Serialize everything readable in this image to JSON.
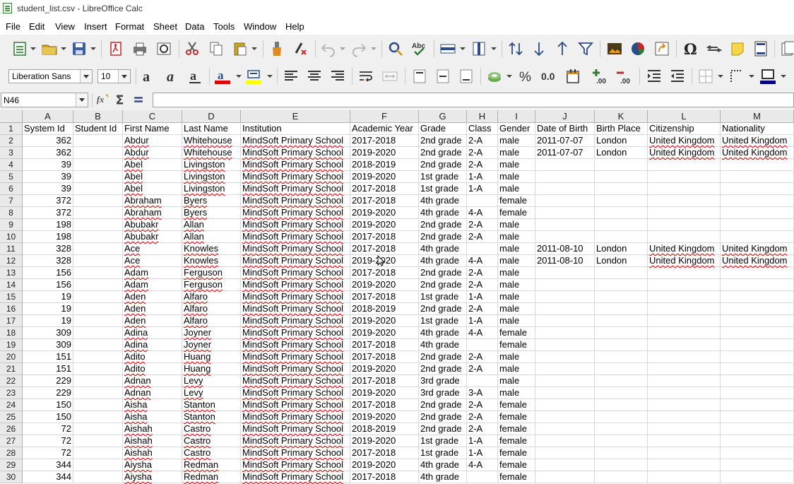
{
  "window": {
    "title": "student_list.csv - LibreOffice Calc"
  },
  "menu": [
    "File",
    "Edit",
    "View",
    "Insert",
    "Format",
    "Sheet",
    "Data",
    "Tools",
    "Window",
    "Help"
  ],
  "format": {
    "font_name": "Liberation Sans",
    "font_size": "10"
  },
  "formula_bar": {
    "cell_ref": "N46",
    "value": ""
  },
  "sheet": {
    "columns": [
      "A",
      "B",
      "C",
      "D",
      "E",
      "F",
      "G",
      "H",
      "I",
      "J",
      "K",
      "L",
      "M"
    ],
    "row_numbers": [
      "1",
      "2",
      "3",
      "4",
      "5",
      "6",
      "7",
      "8",
      "9",
      "10",
      "11",
      "12",
      "13",
      "14",
      "15",
      "16",
      "17",
      "18",
      "19",
      "20",
      "21",
      "22",
      "23",
      "24",
      "25",
      "26",
      "27",
      "28",
      "29",
      "30"
    ],
    "rows": [
      [
        "System Id",
        "Student Id",
        "First Name",
        "Last Name",
        "Institution",
        "Academic Year",
        "Grade",
        "Class",
        "Gender",
        "Date of Birth",
        "Birth Place",
        "Citizenship",
        "Nationality"
      ],
      [
        "362",
        "",
        "Abdur",
        "Whitehouse",
        "MindSoft Primary School",
        "2017-2018",
        "2nd grade",
        "2-A",
        "male",
        "2011-07-07",
        "London",
        "United Kingdom",
        "United Kingdom"
      ],
      [
        "362",
        "",
        "Abdur",
        "Whitehouse",
        "MindSoft Primary School",
        "2019-2020",
        "2nd grade",
        "2-A",
        "male",
        "2011-07-07",
        "London",
        "United Kingdom",
        "United Kingdom"
      ],
      [
        "39",
        "",
        "Abel",
        "Livingston",
        "MindSoft Primary School",
        "2018-2019",
        "2nd grade",
        "2-A",
        "male",
        "",
        "",
        "",
        ""
      ],
      [
        "39",
        "",
        "Abel",
        "Livingston",
        "MindSoft Primary School",
        "2019-2020",
        "1st grade",
        "1-A",
        "male",
        "",
        "",
        "",
        ""
      ],
      [
        "39",
        "",
        "Abel",
        "Livingston",
        "MindSoft Primary School",
        "2017-2018",
        "1st grade",
        "1-A",
        "male",
        "",
        "",
        "",
        ""
      ],
      [
        "372",
        "",
        "Abraham",
        "Byers",
        "MindSoft Primary School",
        "2017-2018",
        "4th grade",
        "",
        "female",
        "",
        "",
        "",
        ""
      ],
      [
        "372",
        "",
        "Abraham",
        "Byers",
        "MindSoft Primary School",
        "2019-2020",
        "4th grade",
        "4-A",
        "female",
        "",
        "",
        "",
        ""
      ],
      [
        "198",
        "",
        "Abubakr",
        "Allan",
        "MindSoft Primary School",
        "2019-2020",
        "2nd grade",
        "2-A",
        "male",
        "",
        "",
        "",
        ""
      ],
      [
        "198",
        "",
        "Abubakr",
        "Allan",
        "MindSoft Primary School",
        "2017-2018",
        "2nd grade",
        "2-A",
        "male",
        "",
        "",
        "",
        ""
      ],
      [
        "328",
        "",
        "Ace",
        "Knowles",
        "MindSoft Primary School",
        "2017-2018",
        "4th grade",
        "",
        "male",
        "2011-08-10",
        "London",
        "United Kingdom",
        "United Kingdom"
      ],
      [
        "328",
        "",
        "Ace",
        "Knowles",
        "MindSoft Primary School",
        "2019-2020",
        "4th grade",
        "4-A",
        "male",
        "2011-08-10",
        "London",
        "United Kingdom",
        "United Kingdom"
      ],
      [
        "156",
        "",
        "Adam",
        "Ferguson",
        "MindSoft Primary School",
        "2017-2018",
        "2nd grade",
        "2-A",
        "male",
        "",
        "",
        "",
        ""
      ],
      [
        "156",
        "",
        "Adam",
        "Ferguson",
        "MindSoft Primary School",
        "2019-2020",
        "2nd grade",
        "2-A",
        "male",
        "",
        "",
        "",
        ""
      ],
      [
        "19",
        "",
        "Aden",
        "Alfaro",
        "MindSoft Primary School",
        "2017-2018",
        "1st grade",
        "1-A",
        "male",
        "",
        "",
        "",
        ""
      ],
      [
        "19",
        "",
        "Aden",
        "Alfaro",
        "MindSoft Primary School",
        "2018-2019",
        "2nd grade",
        "2-A",
        "male",
        "",
        "",
        "",
        ""
      ],
      [
        "19",
        "",
        "Aden",
        "Alfaro",
        "MindSoft Primary School",
        "2019-2020",
        "1st grade",
        "1-A",
        "male",
        "",
        "",
        "",
        ""
      ],
      [
        "309",
        "",
        "Adina",
        "Joyner",
        "MindSoft Primary School",
        "2019-2020",
        "4th grade",
        "4-A",
        "female",
        "",
        "",
        "",
        ""
      ],
      [
        "309",
        "",
        "Adina",
        "Joyner",
        "MindSoft Primary School",
        "2017-2018",
        "4th grade",
        "",
        "female",
        "",
        "",
        "",
        ""
      ],
      [
        "151",
        "",
        "Adito",
        "Huang",
        "MindSoft Primary School",
        "2017-2018",
        "2nd grade",
        "2-A",
        "male",
        "",
        "",
        "",
        ""
      ],
      [
        "151",
        "",
        "Adito",
        "Huang",
        "MindSoft Primary School",
        "2019-2020",
        "2nd grade",
        "2-A",
        "male",
        "",
        "",
        "",
        ""
      ],
      [
        "229",
        "",
        "Adnan",
        "Levy",
        "MindSoft Primary School",
        "2017-2018",
        "3rd grade",
        "",
        "male",
        "",
        "",
        "",
        ""
      ],
      [
        "229",
        "",
        "Adnan",
        "Levy",
        "MindSoft Primary School",
        "2019-2020",
        "3rd grade",
        "3-A",
        "male",
        "",
        "",
        "",
        ""
      ],
      [
        "150",
        "",
        "Aisha",
        "Stanton",
        "MindSoft Primary School",
        "2017-2018",
        "2nd grade",
        "2-A",
        "female",
        "",
        "",
        "",
        ""
      ],
      [
        "150",
        "",
        "Aisha",
        "Stanton",
        "MindSoft Primary School",
        "2019-2020",
        "2nd grade",
        "2-A",
        "female",
        "",
        "",
        "",
        ""
      ],
      [
        "72",
        "",
        "Aishah",
        "Castro",
        "MindSoft Primary School",
        "2018-2019",
        "2nd grade",
        "2-A",
        "female",
        "",
        "",
        "",
        ""
      ],
      [
        "72",
        "",
        "Aishah",
        "Castro",
        "MindSoft Primary School",
        "2019-2020",
        "1st grade",
        "1-A",
        "female",
        "",
        "",
        "",
        ""
      ],
      [
        "72",
        "",
        "Aishah",
        "Castro",
        "MindSoft Primary School",
        "2017-2018",
        "1st grade",
        "1-A",
        "female",
        "",
        "",
        "",
        ""
      ],
      [
        "344",
        "",
        "Aiysha",
        "Redman",
        "MindSoft Primary School",
        "2019-2020",
        "4th grade",
        "4-A",
        "female",
        "",
        "",
        "",
        ""
      ],
      [
        "344",
        "",
        "Aiysha",
        "Redman",
        "MindSoft Primary School",
        "2017-2018",
        "4th grade",
        "",
        "female",
        "",
        "",
        "",
        ""
      ]
    ]
  },
  "colors": {
    "accent_green": "#2e7d32",
    "spellcheck_red": "#e00000",
    "header_bg": "#e9e9e9"
  }
}
